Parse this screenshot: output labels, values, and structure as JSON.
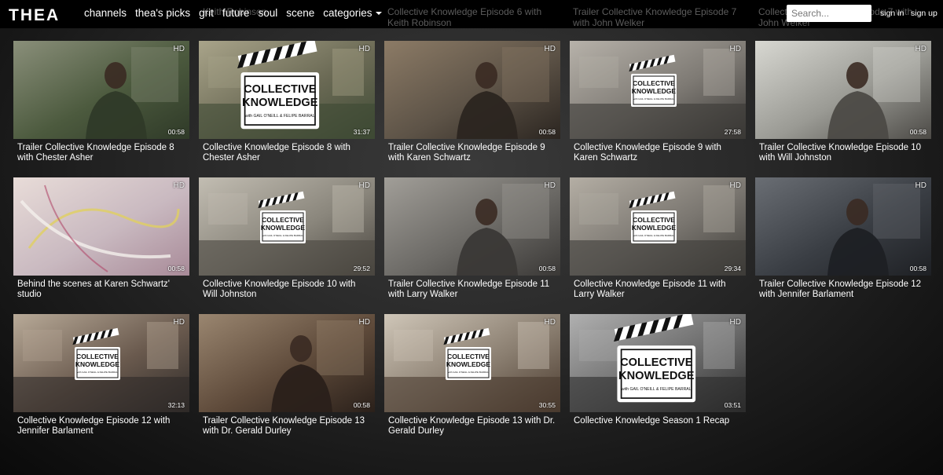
{
  "header": {
    "logo_text": "THEA",
    "nav": [
      {
        "label": "channels"
      },
      {
        "label": "thea's picks"
      },
      {
        "label": "grit"
      },
      {
        "label": "future"
      },
      {
        "label": "soul"
      },
      {
        "label": "scene"
      },
      {
        "label": "categories"
      }
    ],
    "search_placeholder": "Search...",
    "sign_in": "sign in",
    "sign_up": "sign up",
    "background_titles": [
      "Keith Robinson",
      "Collective Knowledge Episode 6 with Keith Robinson",
      "Trailer Collective Knowledge Episode 7 with John Welker",
      "Collective Knowledge Episode 7 with John Welker"
    ]
  },
  "clapper_text": {
    "line1": "COLLECTIVE",
    "line2": "KNOWLEDGE",
    "line3": "with GAIL O'NEILL & FELIPE BARRAL"
  },
  "videos": [
    {
      "title": "Trailer Collective Knowledge Episode 8 with Chester Asher",
      "duration": "00:58",
      "badge": "HD",
      "scene": "man-outdoor",
      "logo": false,
      "colors": [
        "#4c5a3e",
        "#2f3a28",
        "#8a8f7a"
      ]
    },
    {
      "title": "Collective Knowledge Episode 8 with Chester Asher",
      "duration": "31:37",
      "badge": "HD",
      "scene": "outdoor-logo",
      "logo": true,
      "colors": [
        "#6b6a55",
        "#3e4a34",
        "#a9a48a"
      ]
    },
    {
      "title": "Trailer Collective Knowledge Episode 9 with Karen Schwartz",
      "duration": "00:58",
      "badge": "HD",
      "scene": "woman-studio",
      "logo": false,
      "colors": [
        "#5d5347",
        "#2b2520",
        "#8c7b66"
      ]
    },
    {
      "title": "Collective Knowledge Episode 9 with Karen Schwartz",
      "duration": "27:58",
      "badge": "HD",
      "scene": "gallery-logo",
      "logo": true,
      "colors": [
        "#7e7a74",
        "#3a3836",
        "#b7b2aa"
      ]
    },
    {
      "title": "Trailer Collective Knowledge Episode 10 with Will Johnston",
      "duration": "00:58",
      "badge": "HD",
      "scene": "man-window",
      "logo": false,
      "colors": [
        "#9a9a94",
        "#4c4a46",
        "#d8d8d2"
      ]
    },
    {
      "title": "Behind the scenes at Karen Schwartz' studio",
      "duration": "00:58",
      "badge": "HD",
      "scene": "painting",
      "logo": false,
      "colors": [
        "#c9b9c0",
        "#a88a98",
        "#e8dcd8"
      ]
    },
    {
      "title": "Collective Knowledge Episode 10 with Will Johnston",
      "duration": "29:52",
      "badge": "HD",
      "scene": "room-logo",
      "logo": true,
      "colors": [
        "#8a867c",
        "#4a4640",
        "#c2bdb2"
      ]
    },
    {
      "title": "Trailer Collective Knowledge Episode 11 with Larry Walker",
      "duration": "00:58",
      "badge": "HD",
      "scene": "man-gallery",
      "logo": false,
      "colors": [
        "#6c6a66",
        "#3a3836",
        "#a19e98"
      ]
    },
    {
      "title": "Collective Knowledge Episode 11 with Larry Walker",
      "duration": "29:34",
      "badge": "HD",
      "scene": "gallery2-logo",
      "logo": true,
      "colors": [
        "#7a7670",
        "#3e3c38",
        "#b4aea4"
      ]
    },
    {
      "title": "Trailer Collective Knowledge Episode 12 with Jennifer Barlament",
      "duration": "00:58",
      "badge": "HD",
      "scene": "woman-lobby",
      "logo": false,
      "colors": [
        "#3a3e44",
        "#1e2024",
        "#6a6e74"
      ]
    },
    {
      "title": "Collective Knowledge Episode 12 with Jennifer Barlament",
      "duration": "32:13",
      "badge": "HD",
      "scene": "lobby-logo",
      "logo": true,
      "colors": [
        "#6a5a4e",
        "#2e2a28",
        "#b8aa98"
      ]
    },
    {
      "title": "Trailer Collective Knowledge Episode 13 with Dr. Gerald Durley",
      "duration": "00:58",
      "badge": "HD",
      "scene": "man-office",
      "logo": false,
      "colors": [
        "#5e4a3a",
        "#2a201a",
        "#9a8670"
      ]
    },
    {
      "title": "Collective Knowledge Episode 13 with Dr. Gerald Durley",
      "duration": "30:55",
      "badge": "HD",
      "scene": "church-logo",
      "logo": true,
      "colors": [
        "#8a7e70",
        "#4a3a2e",
        "#cfc6b8"
      ]
    },
    {
      "title": "Collective Knowledge Season 1 Recap",
      "duration": "03:51",
      "badge": "HD",
      "scene": "bw-logo",
      "logo": true,
      "colors": [
        "#6c6c6c",
        "#2c2c2c",
        "#b0b0b0"
      ]
    }
  ]
}
